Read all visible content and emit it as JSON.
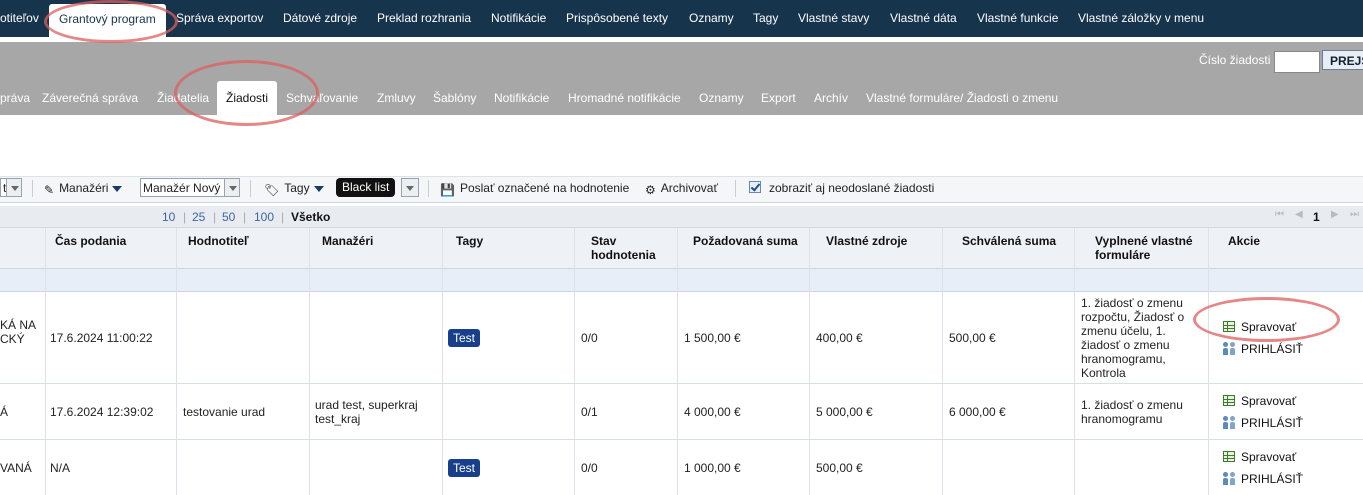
{
  "top_nav": [
    "otiteľov",
    "Grantový program",
    "Správa exportov",
    "Dátové zdroje",
    "Preklad rozhrania",
    "Notifikácie",
    "Prispôsobené texty",
    "Oznamy",
    "Tagy",
    "Vlastné stavy",
    "Vlastné dáta",
    "Vlastné funkcie",
    "Vlastné záložky v menu"
  ],
  "request_search": {
    "label": "Číslo žiadosti",
    "button": "PREJS"
  },
  "sub_nav": [
    "práva",
    "Záverečná správa",
    "Žiadatelia",
    "Žiadosti",
    "Schvaľovanie",
    "Zmluvy",
    "Šablóny",
    "Notifikácie",
    "Hromadné notifikácie",
    "Oznamy",
    "Export",
    "Archív",
    "Vlastné formuláre/ Žiadosti o zmenu"
  ],
  "toolbar": {
    "partial_select": "t",
    "managers_label": "Manažéri",
    "manager_select": "Manažér Nový",
    "tags_label": "Tagy",
    "tag_select": "Black list",
    "send_rated": "Poslať označené na hodnotenie",
    "archive": "Archivovať",
    "show_unsent": "zobraziť aj neodoslané žiadosti"
  },
  "pager": {
    "sizes": [
      "10",
      "25",
      "50",
      "100"
    ],
    "all": "Všetko",
    "current_page": "1",
    "nav_first": "⏮",
    "nav_prev": "◀",
    "nav_next": "▶",
    "nav_last": "⏭"
  },
  "columns": [
    "Čas podania",
    "Hodnotiteľ",
    "Manažéri",
    "Tagy",
    "Stav hodnotenia",
    "Požadovaná suma",
    "Vlastné zdroje",
    "Schválená suma",
    "Vyplnené vlastné formuláre",
    "Akcie"
  ],
  "rows": [
    {
      "name": "KÁ NA CKÝ",
      "time": "17.6.2024 11:00:22",
      "rater": "",
      "managers": "",
      "tag": "Test",
      "rating": "0/0",
      "requested": "1 500,00 €",
      "own": "400,00 €",
      "approved": "500,00 €",
      "forms": "1. žiadosť o zmenu rozpočtu, Žiadosť o zmenu účelu, 1. žiadosť o zmenu hranomogramu, Kontrola"
    },
    {
      "name": "Á",
      "time": "17.6.2024 12:39:02",
      "rater": "testovanie urad",
      "managers": "urad test, superkraj test_kraj",
      "tag": "",
      "rating": "0/1",
      "requested": "4 000,00 €",
      "own": "5 000,00 €",
      "approved": "6 000,00 €",
      "forms": "1. žiadosť o zmenu hranomogramu"
    },
    {
      "name": "VANÁ",
      "time": "N/A",
      "rater": "",
      "managers": "",
      "tag": "Test",
      "rating": "0/0",
      "requested": "1 000,00 €",
      "own": "500,00 €",
      "approved": "",
      "forms": ""
    }
  ],
  "actions": {
    "manage": "Spravovať",
    "login": "PRIHLÁSIŤ"
  },
  "colors": {
    "topnav_bg": "#17344d",
    "subnav_bg": "#a7a7a7",
    "tag_bg": "#173f8c",
    "annotation": "#dc5f5f"
  }
}
